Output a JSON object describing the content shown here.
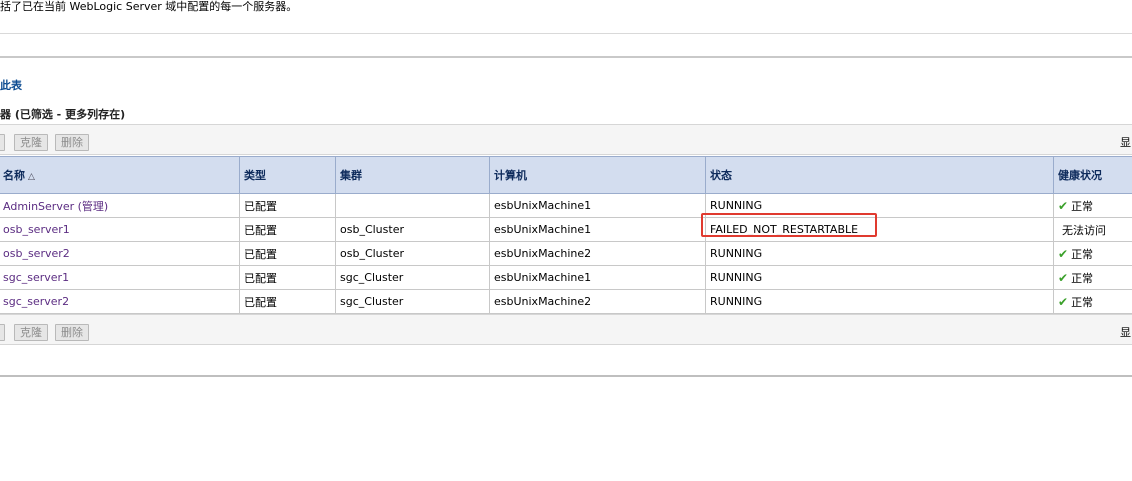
{
  "page": {
    "description": "括了已在当前 WebLogic Server 域中配置的每一个服务器。",
    "customize_link": "此表",
    "table_title": "器 (已筛选 - 更多列存在)"
  },
  "toolbar": {
    "clone_label": "克隆",
    "delete_label": "删除",
    "show_label": "显"
  },
  "table": {
    "headers": {
      "name": "名称",
      "type": "类型",
      "cluster": "集群",
      "machine": "计算机",
      "state": "状态",
      "health": "健康状况"
    },
    "rows": [
      {
        "name": "AdminServer (管理)",
        "type": "已配置",
        "cluster": "",
        "machine": "esbUnixMachine1",
        "state": "RUNNING",
        "health": "正常",
        "healthy": true
      },
      {
        "name": "osb_server1",
        "type": "已配置",
        "cluster": "osb_Cluster",
        "machine": "esbUnixMachine1",
        "state": "FAILED_NOT_RESTARTABLE",
        "health": "无法访问",
        "healthy": false
      },
      {
        "name": "osb_server2",
        "type": "已配置",
        "cluster": "osb_Cluster",
        "machine": "esbUnixMachine2",
        "state": "RUNNING",
        "health": "正常",
        "healthy": true
      },
      {
        "name": "sgc_server1",
        "type": "已配置",
        "cluster": "sgc_Cluster",
        "machine": "esbUnixMachine1",
        "state": "RUNNING",
        "health": "正常",
        "healthy": true
      },
      {
        "name": "sgc_server2",
        "type": "已配置",
        "cluster": "sgc_Cluster",
        "machine": "esbUnixMachine2",
        "state": "RUNNING",
        "health": "正常",
        "healthy": true
      }
    ]
  },
  "colors": {
    "header_bg": "#d3ddef",
    "header_text": "#0e2b5c",
    "name_link": "#5b2c82",
    "ok_check": "#3aa02a",
    "highlight_border": "#e03a2f"
  },
  "icons": {
    "sort": "sort-ascending-icon",
    "health_ok": "check-icon"
  }
}
